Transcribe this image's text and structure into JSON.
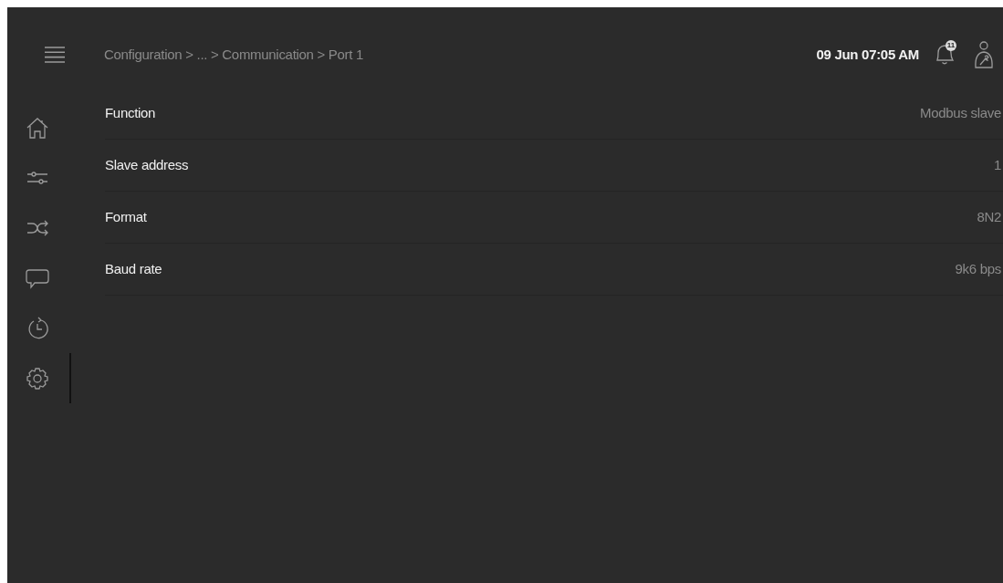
{
  "header": {
    "breadcrumb": "Configuration > ... > Communication > Port 1",
    "datetime": "09 Jun 07:05 AM",
    "alarm_count": "11"
  },
  "sidebar": {
    "items": [
      {
        "kind": "home",
        "selected": false
      },
      {
        "kind": "sliders",
        "selected": false
      },
      {
        "kind": "shuffle",
        "selected": false
      },
      {
        "kind": "chat",
        "selected": false
      },
      {
        "kind": "history",
        "selected": false
      },
      {
        "kind": "gear",
        "selected": true
      }
    ]
  },
  "settings": [
    {
      "label": "Function",
      "value": "Modbus slave"
    },
    {
      "label": "Slave address",
      "value": "1"
    },
    {
      "label": "Format",
      "value": "8N2"
    },
    {
      "label": "Baud rate",
      "value": "9k6 bps"
    }
  ]
}
